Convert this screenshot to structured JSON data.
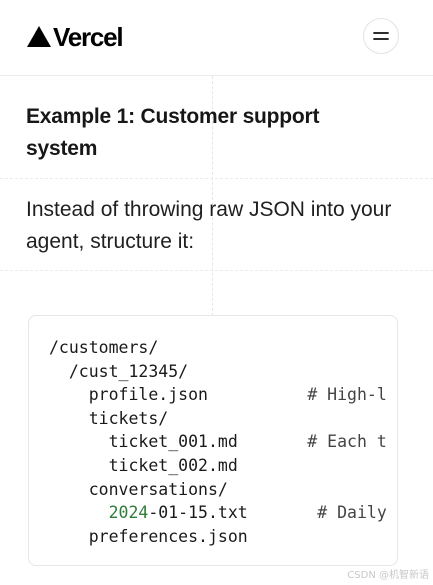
{
  "header": {
    "brand": "Vercel",
    "menu_icon": "menu-icon"
  },
  "article": {
    "heading": "Example 1: Customer support system",
    "paragraph": "Instead of throwing raw JSON into your agent, structure it:"
  },
  "code_block": {
    "lines": [
      {
        "indent": "",
        "text": "/customers/",
        "comment": ""
      },
      {
        "indent": "  ",
        "text": "/cust_12345/",
        "comment": ""
      },
      {
        "indent": "    ",
        "text": "profile.json",
        "pad": "          ",
        "comment": "# High-l"
      },
      {
        "indent": "    ",
        "text": "tickets/",
        "comment": ""
      },
      {
        "indent": "      ",
        "text": "ticket_001.md",
        "pad": "       ",
        "comment": "# Each t"
      },
      {
        "indent": "      ",
        "text": "ticket_002.md",
        "comment": ""
      },
      {
        "indent": "    ",
        "text": "conversations/",
        "comment": ""
      },
      {
        "indent": "      ",
        "num": "2024",
        "text": "-01-15.txt",
        "pad": "       ",
        "comment": "# Daily"
      },
      {
        "indent": "    ",
        "text": "preferences.json",
        "comment": ""
      }
    ]
  },
  "watermark": "CSDN @机智新语",
  "colors": {
    "text": "#171717",
    "number_highlight": "#2f7d3a",
    "border": "#e6e6e6"
  }
}
